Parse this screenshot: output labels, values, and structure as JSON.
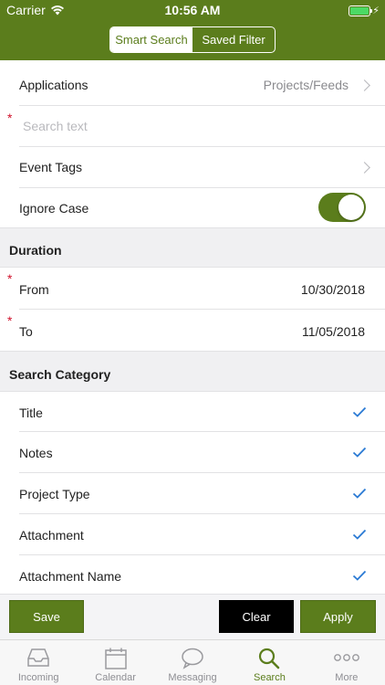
{
  "status_bar": {
    "carrier": "Carrier",
    "time": "10:56 AM"
  },
  "header": {
    "segments": [
      "Smart Search",
      "Saved Filter"
    ],
    "active_segment": 0
  },
  "form": {
    "applications": {
      "label": "Applications",
      "value": "Projects/Feeds"
    },
    "search": {
      "required_mark": "*",
      "placeholder": "Search text"
    },
    "event_tags": {
      "label": "Event Tags"
    },
    "ignore_case": {
      "label": "Ignore Case",
      "on": true
    }
  },
  "duration": {
    "title": "Duration",
    "from": {
      "required_mark": "*",
      "label": "From",
      "value": "10/30/2018"
    },
    "to": {
      "required_mark": "*",
      "label": "To",
      "value": "11/05/2018"
    }
  },
  "search_category": {
    "title": "Search Category",
    "items": [
      {
        "label": "Title",
        "checked": true
      },
      {
        "label": "Notes",
        "checked": true
      },
      {
        "label": "Project Type",
        "checked": true
      },
      {
        "label": "Attachment",
        "checked": true
      },
      {
        "label": "Attachment Name",
        "checked": true
      }
    ]
  },
  "actions": {
    "save": "Save",
    "clear": "Clear",
    "apply": "Apply"
  },
  "tabbar": {
    "items": [
      {
        "label": "Incoming",
        "icon": "inbox-icon"
      },
      {
        "label": "Calendar",
        "icon": "calendar-icon"
      },
      {
        "label": "Messaging",
        "icon": "chat-bubble-icon"
      },
      {
        "label": "Search",
        "icon": "search-icon"
      },
      {
        "label": "More",
        "icon": "more-dots-icon"
      }
    ],
    "active": 3
  },
  "colors": {
    "brand": "#5b7d1c",
    "required": "#d0112b",
    "check": "#2a7ad4"
  }
}
